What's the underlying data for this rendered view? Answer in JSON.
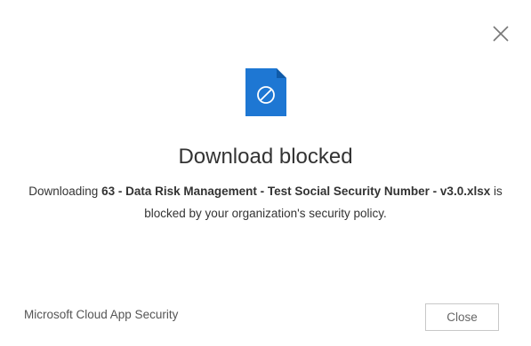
{
  "dialog": {
    "close_icon": "close-icon",
    "file_icon": "blocked-file-icon",
    "title": "Download blocked",
    "message": {
      "prefix": "Downloading ",
      "filename": "63 - Data Risk Management - Test Social Security Number - v3.0.xlsx",
      "suffix": " is blocked by your organization's security policy."
    },
    "brand": "Microsoft Cloud App Security",
    "close_button_label": "Close",
    "colors": {
      "accent": "#1e77d3",
      "text": "#333333",
      "button_border": "#c8c8c8"
    }
  }
}
